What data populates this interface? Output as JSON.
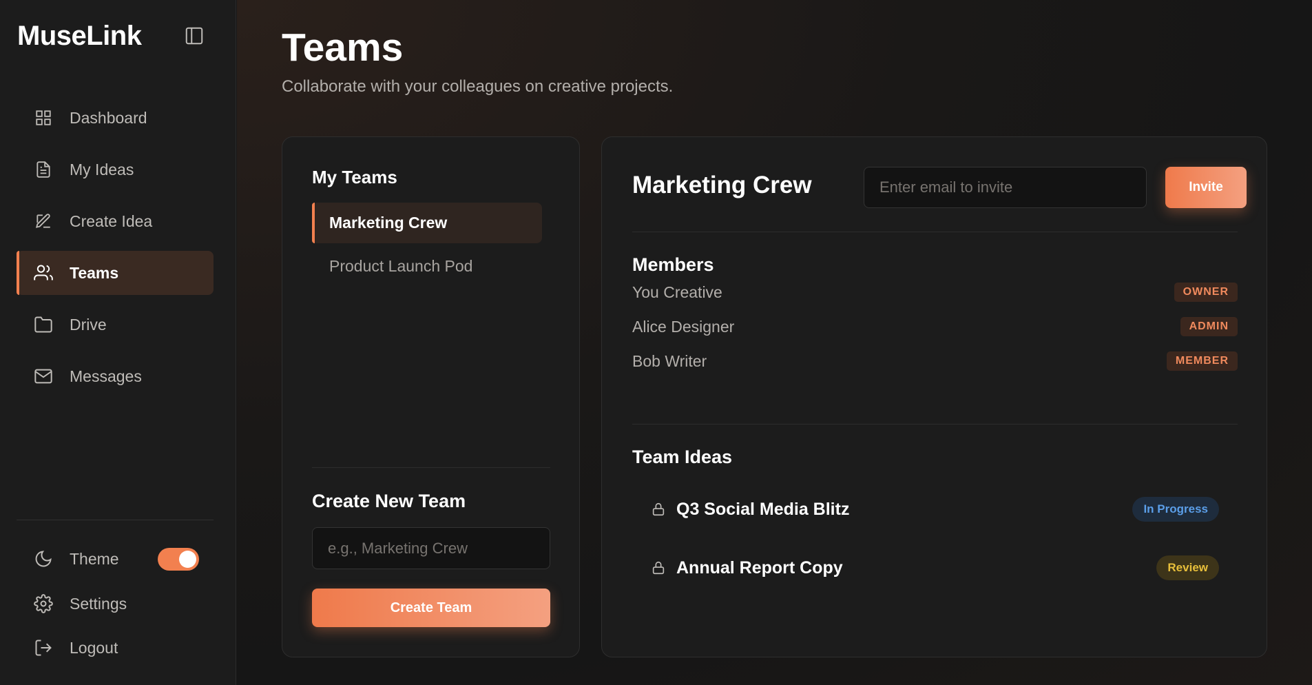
{
  "app": {
    "name": "MuseLink"
  },
  "sidebar": {
    "items": [
      {
        "label": "Dashboard",
        "icon": "grid-icon"
      },
      {
        "label": "My Ideas",
        "icon": "document-icon"
      },
      {
        "label": "Create Idea",
        "icon": "edit-icon"
      },
      {
        "label": "Teams",
        "icon": "users-icon",
        "active": true
      },
      {
        "label": "Drive",
        "icon": "folder-icon"
      },
      {
        "label": "Messages",
        "icon": "mail-icon"
      }
    ],
    "theme_label": "Theme",
    "theme_toggle_on": true,
    "settings_label": "Settings",
    "logout_label": "Logout"
  },
  "page": {
    "title": "Teams",
    "subtitle": "Collaborate with your colleagues on creative projects."
  },
  "my_teams": {
    "heading": "My Teams",
    "teams": [
      {
        "name": "Marketing Crew",
        "active": true
      },
      {
        "name": "Product Launch Pod",
        "active": false
      }
    ],
    "create_heading": "Create New Team",
    "create_placeholder": "e.g., Marketing Crew",
    "create_button": "Create Team"
  },
  "team_detail": {
    "name": "Marketing Crew",
    "invite_placeholder": "Enter email to invite",
    "invite_button": "Invite",
    "members_heading": "Members",
    "members": [
      {
        "name": "You Creative",
        "role": "OWNER"
      },
      {
        "name": "Alice Designer",
        "role": "ADMIN"
      },
      {
        "name": "Bob Writer",
        "role": "MEMBER"
      }
    ],
    "ideas_heading": "Team Ideas",
    "ideas": [
      {
        "title": "Q3 Social Media Blitz",
        "status": "In Progress",
        "icon": "lock-icon"
      },
      {
        "title": "Annual Report Copy",
        "status": "Review",
        "icon": "lock-icon"
      }
    ]
  },
  "colors": {
    "accent": "#f2804f",
    "status_in_progress": "#5b9ee8",
    "status_review": "#e8bf3b"
  }
}
